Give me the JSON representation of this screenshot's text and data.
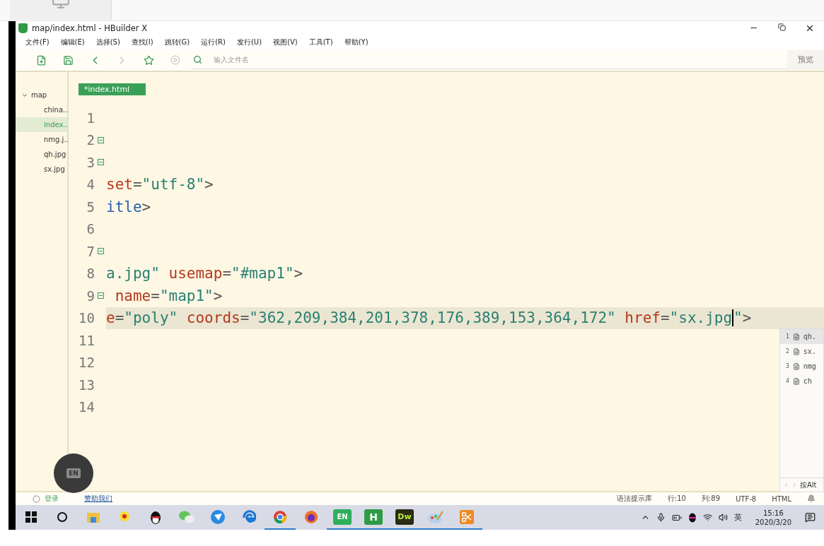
{
  "window": {
    "title": "map/index.html - HBuilder X"
  },
  "menu": [
    "文件(F)",
    "编辑(E)",
    "选择(S)",
    "查找(I)",
    "跳转(G)",
    "运行(R)",
    "发行(U)",
    "视图(V)",
    "工具(T)",
    "帮助(Y)"
  ],
  "toolbar": {
    "buttons": [
      {
        "kind": "new-file",
        "disabled": false
      },
      {
        "kind": "save",
        "disabled": false
      },
      {
        "kind": "back",
        "disabled": false
      },
      {
        "kind": "forward",
        "disabled": true
      },
      {
        "kind": "favorite",
        "disabled": false
      },
      {
        "kind": "run",
        "disabled": true
      }
    ],
    "search": {
      "placeholder": "输入文件名"
    },
    "preview": "预览"
  },
  "sidebar": {
    "items": [
      {
        "label": "map",
        "expanded": true,
        "selected": false,
        "children": [
          {
            "label": "china..",
            "selected": false
          },
          {
            "label": "index..",
            "selected": true
          },
          {
            "label": "nmg.j..",
            "selected": false
          },
          {
            "label": "qh.jpg",
            "selected": false
          },
          {
            "label": "sx.jpg",
            "selected": false
          }
        ]
      }
    ]
  },
  "tabs": [
    {
      "label": "*index.html",
      "selected": true
    }
  ],
  "editor": {
    "lines": [
      {
        "number": "1",
        "fold": false,
        "current": false
      },
      {
        "number": "2",
        "fold": true,
        "current": false
      },
      {
        "number": "3",
        "fold": true,
        "current": false
      },
      {
        "number": "4",
        "fold": false,
        "current": false,
        "tokens": [
          {
            "kind": "attr",
            "text": "set"
          },
          {
            "kind": "punct",
            "text": "="
          },
          {
            "kind": "string",
            "text": "\"utf-8\""
          },
          {
            "kind": "punct",
            "text": ">"
          }
        ]
      },
      {
        "number": "5",
        "fold": false,
        "current": false,
        "tokens": [
          {
            "kind": "tag",
            "text": "itle"
          },
          {
            "kind": "punct",
            "text": ">"
          }
        ]
      },
      {
        "number": "6",
        "fold": false,
        "current": false
      },
      {
        "number": "7",
        "fold": true,
        "current": false
      },
      {
        "number": "8",
        "fold": false,
        "current": false,
        "tokens": [
          {
            "kind": "string",
            "text": "a.jpg\""
          },
          {
            "kind": "attr",
            "text": " usemap"
          },
          {
            "kind": "punct",
            "text": "="
          },
          {
            "kind": "string",
            "text": "\"#map1\""
          },
          {
            "kind": "punct",
            "text": ">"
          }
        ]
      },
      {
        "number": "9",
        "fold": true,
        "current": false,
        "tokens": [
          {
            "kind": "attr",
            "text": " name"
          },
          {
            "kind": "punct",
            "text": "="
          },
          {
            "kind": "string",
            "text": "\"map1\""
          },
          {
            "kind": "punct",
            "text": ">"
          }
        ]
      },
      {
        "number": "10",
        "fold": false,
        "current": true,
        "tokens": [
          {
            "kind": "attr",
            "text": "e"
          },
          {
            "kind": "punct",
            "text": "="
          },
          {
            "kind": "string",
            "text": "\"poly\""
          },
          {
            "kind": "attr",
            "text": " coords"
          },
          {
            "kind": "punct",
            "text": "="
          },
          {
            "kind": "string",
            "text": "\"362,209,384,201,378,176,389,153,364,172\""
          },
          {
            "kind": "attr",
            "text": " href"
          },
          {
            "kind": "punct",
            "text": "="
          },
          {
            "kind": "string",
            "text": "\"sx.jpg"
          },
          {
            "kind": "caret"
          },
          {
            "kind": "string",
            "text": "\""
          },
          {
            "kind": "punct",
            "text": ">"
          }
        ]
      },
      {
        "number": "11",
        "fold": false,
        "current": false
      },
      {
        "number": "12",
        "fold": false,
        "current": false
      },
      {
        "number": "13",
        "fold": false,
        "current": false
      },
      {
        "number": "14",
        "fold": false,
        "current": false
      }
    ]
  },
  "autocomplete": {
    "items": [
      {
        "index": "1",
        "label": "qh.",
        "selected": true
      },
      {
        "index": "2",
        "label": "sx.",
        "selected": false
      },
      {
        "index": "3",
        "label": "nmg",
        "selected": false
      },
      {
        "index": "4",
        "label": "ch",
        "selected": false
      }
    ],
    "footer": "按Alt"
  },
  "floating_widget": {
    "label": "EN"
  },
  "status_bar": {
    "login": "登录",
    "sponsor": "赞助我们",
    "items": [
      "语法提示库",
      "行:10",
      "列:89",
      "UTF-8",
      "HTML"
    ]
  },
  "taskbar": {
    "apps": [
      {
        "kind": "start",
        "running": false
      },
      {
        "kind": "search",
        "running": false
      },
      {
        "kind": "folder",
        "running": false
      },
      {
        "kind": "pin",
        "running": false
      },
      {
        "kind": "penguin",
        "running": false
      },
      {
        "kind": "chat",
        "running": false
      },
      {
        "kind": "bird",
        "running": false
      },
      {
        "kind": "edge",
        "running": false
      },
      {
        "kind": "chrome",
        "running": true
      },
      {
        "kind": "firefox",
        "running": false
      },
      {
        "kind": "en",
        "label": "EN",
        "running": true
      },
      {
        "kind": "hbuilder",
        "label": "H",
        "running": true
      },
      {
        "kind": "dw",
        "label": "Dw",
        "running": true
      },
      {
        "kind": "paint",
        "running": true
      },
      {
        "kind": "scissors",
        "running": true
      }
    ],
    "tray": {
      "language": "英",
      "time": "15:16",
      "date": "2020/3/20"
    }
  }
}
